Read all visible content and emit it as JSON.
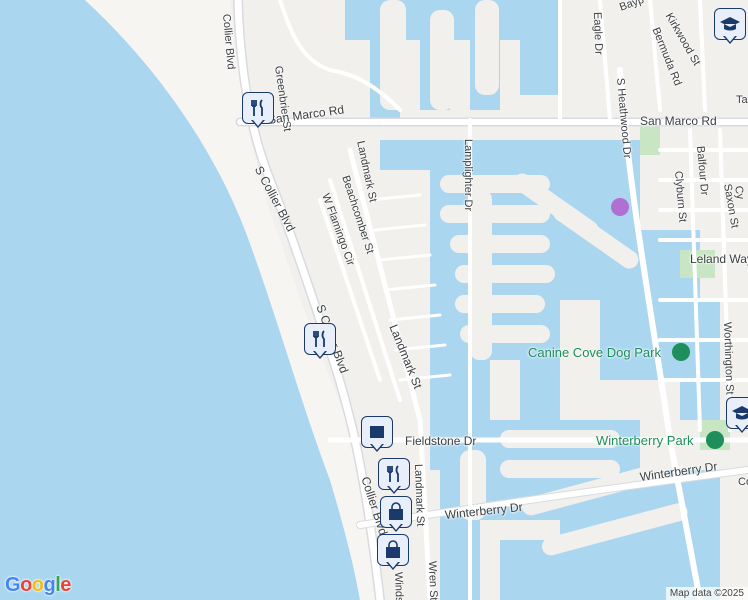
{
  "map": {
    "colors": {
      "water": "#abd6f0",
      "land": "#f2f0ec",
      "road": "#ffffff",
      "park": "#c8e6c4",
      "marker": "#1a3a6b"
    },
    "roads": [
      {
        "id": "collier-n",
        "text": "Collier Blvd"
      },
      {
        "id": "greenbrier",
        "text": "Greenbrier St"
      },
      {
        "id": "san-marco-w",
        "text": "San Marco Rd"
      },
      {
        "id": "san-marco-e",
        "text": "San Marco Rd"
      },
      {
        "id": "s-collier",
        "text": "S Collier Blvd"
      },
      {
        "id": "landmark-n",
        "text": "Landmark St"
      },
      {
        "id": "beachcomber",
        "text": "Beachcomber St"
      },
      {
        "id": "flamingo",
        "text": "W Flamingo Cir"
      },
      {
        "id": "lamplighter",
        "text": "Lamplighter Dr"
      },
      {
        "id": "eagle",
        "text": "Eagle Dr"
      },
      {
        "id": "s-heathwood",
        "text": "S Heathwood Dr"
      },
      {
        "id": "kirkwood",
        "text": "Kirkwood St"
      },
      {
        "id": "bermuda",
        "text": "Bermuda Rd"
      },
      {
        "id": "bayport",
        "text": "Bayp"
      },
      {
        "id": "ta",
        "text": "Ta"
      },
      {
        "id": "balfour",
        "text": "Balfour Dr"
      },
      {
        "id": "clyburn",
        "text": "Clyburn St"
      },
      {
        "id": "saxon",
        "text": "Saxon St"
      },
      {
        "id": "cy",
        "text": "Cy"
      },
      {
        "id": "leland",
        "text": "Leland Way"
      },
      {
        "id": "landmark-s",
        "text": "Landmark St"
      },
      {
        "id": "collier-blvd-mid",
        "text": "S Collier Blvd"
      },
      {
        "id": "fieldstone",
        "text": "Fieldstone Dr"
      },
      {
        "id": "winterberry-e",
        "text": "Winterberry Dr"
      },
      {
        "id": "winterberry-w",
        "text": "Winterberry Dr"
      },
      {
        "id": "worthington",
        "text": "Worthington St"
      },
      {
        "id": "landmark-s2",
        "text": "Landmark St"
      },
      {
        "id": "collier-s",
        "text": "Collier Blvd"
      },
      {
        "id": "wren",
        "text": "Wren St"
      },
      {
        "id": "windsong",
        "text": "Windsong"
      },
      {
        "id": "co",
        "text": "Co"
      }
    ],
    "pois": [
      {
        "id": "canine-cove",
        "text": "Canine Cove Dog Park"
      },
      {
        "id": "winterberry-park",
        "text": "Winterberry Park"
      }
    ],
    "markers": [
      {
        "id": "restaurant-1",
        "icon": "restaurant-icon"
      },
      {
        "id": "restaurant-2",
        "icon": "restaurant-icon"
      },
      {
        "id": "school-1",
        "icon": "school-icon"
      },
      {
        "id": "school-2",
        "icon": "school-icon"
      },
      {
        "id": "store-1",
        "icon": "store-icon"
      },
      {
        "id": "restaurant-3",
        "icon": "restaurant-icon"
      },
      {
        "id": "shopping-1",
        "icon": "shopping-bag-icon"
      },
      {
        "id": "shopping-2",
        "icon": "shopping-bag-icon"
      }
    ],
    "attribution": {
      "logo": "Google",
      "data": "Map data ©2025"
    }
  }
}
